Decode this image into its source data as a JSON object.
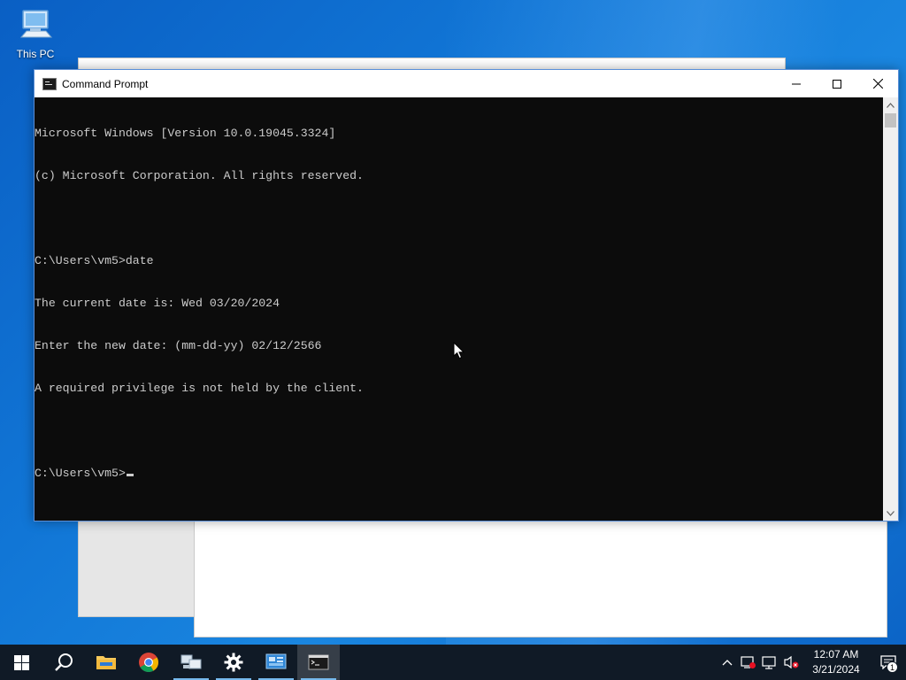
{
  "desktop": {
    "icons": [
      {
        "label": "This PC",
        "icon": "this-pc-icon"
      }
    ]
  },
  "cmd_window": {
    "title": "Command Prompt",
    "app_icon": "cmd-icon",
    "controls": {
      "minimize": "minimize-icon",
      "maximize": "maximize-icon",
      "close": "close-icon"
    },
    "lines": [
      "Microsoft Windows [Version 10.0.19045.3324]",
      "(c) Microsoft Corporation. All rights reserved.",
      "",
      "C:\\Users\\vm5>date",
      "The current date is: Wed 03/20/2024",
      "Enter the new date: (mm-dd-yy) 02/12/2566",
      "A required privilege is not held by the client.",
      ""
    ],
    "prompt": "C:\\Users\\vm5>"
  },
  "taskbar": {
    "items": [
      {
        "name": "start-button",
        "icon": "windows-logo-icon",
        "active": false,
        "running": false
      },
      {
        "name": "search-button",
        "icon": "search-icon",
        "active": false,
        "running": false
      },
      {
        "name": "file-explorer-button",
        "icon": "folder-icon",
        "active": false,
        "running": false
      },
      {
        "name": "chrome-button",
        "icon": "chrome-icon",
        "active": false,
        "running": false
      },
      {
        "name": "network-app-button",
        "icon": "network-computers-icon",
        "active": false,
        "running": true
      },
      {
        "name": "settings-button",
        "icon": "gear-icon",
        "active": false,
        "running": true
      },
      {
        "name": "control-panel-button",
        "icon": "control-panel-icon",
        "active": false,
        "running": true
      },
      {
        "name": "command-prompt-button",
        "icon": "cmd-icon",
        "active": true,
        "running": true
      }
    ],
    "tray": {
      "icons": [
        "chevron-up-icon",
        "network-warning-icon",
        "network-icon",
        "volume-muted-icon"
      ],
      "time": "12:07 AM",
      "date": "3/21/2024",
      "notification_count": "1"
    }
  },
  "colors": {
    "console_bg": "#0c0c0c",
    "console_text": "#cccccc",
    "taskbar_bg": "#101a26",
    "accent": "#76b9ed"
  }
}
